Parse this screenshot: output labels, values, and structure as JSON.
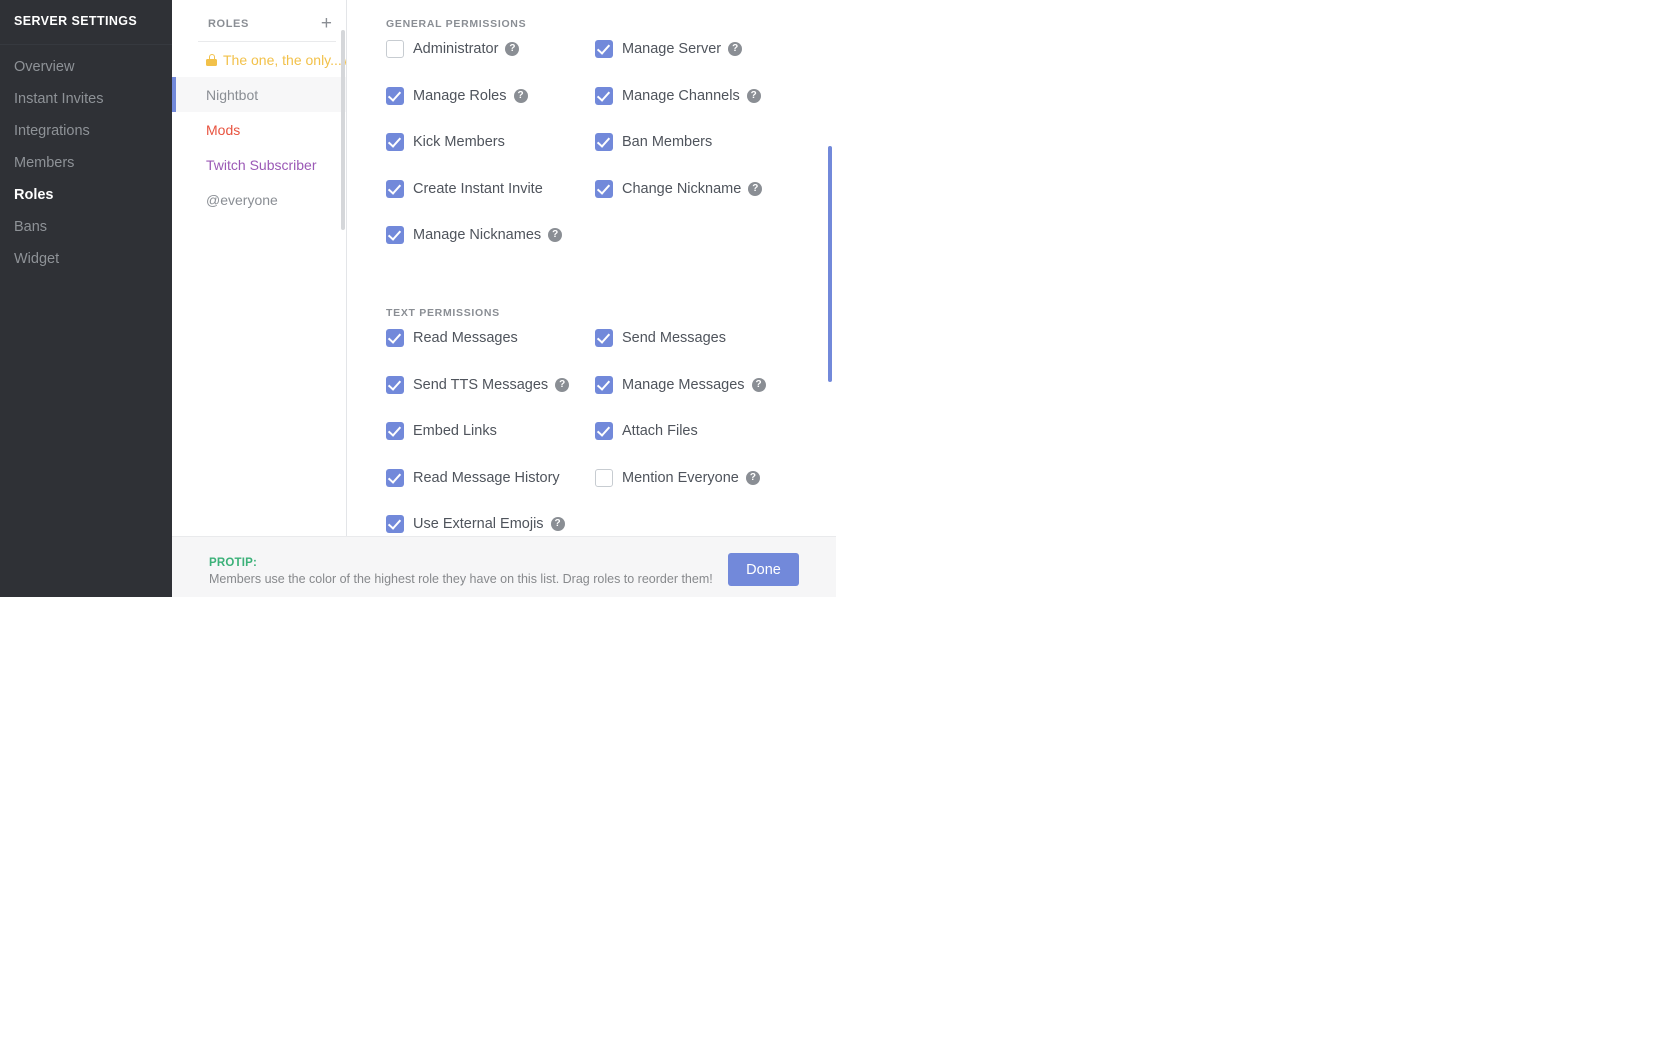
{
  "sidebar": {
    "title": "SERVER SETTINGS",
    "items": [
      {
        "label": "Overview",
        "active": false
      },
      {
        "label": "Instant Invites",
        "active": false
      },
      {
        "label": "Integrations",
        "active": false
      },
      {
        "label": "Members",
        "active": false
      },
      {
        "label": "Roles",
        "active": true
      },
      {
        "label": "Bans",
        "active": false
      },
      {
        "label": "Widget",
        "active": false
      }
    ]
  },
  "roles_panel": {
    "header_label": "ROLES",
    "add_icon": "plus-icon",
    "add_label": "+",
    "roles": [
      {
        "label": "The one, the only...w",
        "color": "#f2c14a",
        "locked": true,
        "selected": false
      },
      {
        "label": "Nightbot",
        "color": "#8a8e94",
        "locked": false,
        "selected": true
      },
      {
        "label": "Mods",
        "color": "#e8533f",
        "locked": false,
        "selected": false
      },
      {
        "label": "Twitch Subscriber",
        "color": "#9b59b6",
        "locked": false,
        "selected": false
      },
      {
        "label": "@everyone",
        "color": "#8a8e94",
        "locked": false,
        "selected": false
      }
    ]
  },
  "permissions": {
    "sections": [
      {
        "label": "GENERAL PERMISSIONS",
        "items": [
          {
            "label": "Administrator",
            "checked": false,
            "help": true
          },
          {
            "label": "Manage Server",
            "checked": true,
            "help": true
          },
          {
            "label": "Manage Roles",
            "checked": true,
            "help": true
          },
          {
            "label": "Manage Channels",
            "checked": true,
            "help": true
          },
          {
            "label": "Kick Members",
            "checked": true,
            "help": false
          },
          {
            "label": "Ban Members",
            "checked": true,
            "help": false
          },
          {
            "label": "Create Instant Invite",
            "checked": true,
            "help": false
          },
          {
            "label": "Change Nickname",
            "checked": true,
            "help": true
          },
          {
            "label": "Manage Nicknames",
            "checked": true,
            "help": true
          }
        ]
      },
      {
        "label": "TEXT PERMISSIONS",
        "items": [
          {
            "label": "Read Messages",
            "checked": true,
            "help": false
          },
          {
            "label": "Send Messages",
            "checked": true,
            "help": false
          },
          {
            "label": "Send TTS Messages",
            "checked": true,
            "help": true
          },
          {
            "label": "Manage Messages",
            "checked": true,
            "help": true
          },
          {
            "label": "Embed Links",
            "checked": true,
            "help": false
          },
          {
            "label": "Attach Files",
            "checked": true,
            "help": false
          },
          {
            "label": "Read Message History",
            "checked": true,
            "help": false
          },
          {
            "label": "Mention Everyone",
            "checked": false,
            "help": true
          },
          {
            "label": "Use External Emojis",
            "checked": true,
            "help": true
          }
        ]
      }
    ],
    "help_glyph": "?"
  },
  "footer": {
    "protip_title": "PROTIP:",
    "protip_body": "Members use the color of the highest role they have on this list. Drag roles to reorder them!",
    "done_label": "Done"
  },
  "colors": {
    "accent": "#7289da",
    "sidebar_bg": "#2f3136",
    "protip_green": "#3cb179",
    "scrollbar_perms": "#7289da",
    "scrollbar_roles": "#d5d7da"
  }
}
